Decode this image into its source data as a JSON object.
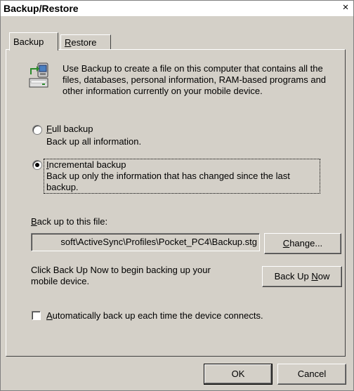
{
  "window": {
    "title": "Backup/Restore",
    "close_glyph": "×"
  },
  "tabs": [
    {
      "label_mnemonic": "",
      "label_rest": "Backup",
      "active": true
    },
    {
      "label_mnemonic": "R",
      "label_rest": "estore",
      "active": false
    }
  ],
  "intro_text": "Use Backup to create a file on this computer that contains all the files, databases, personal information, RAM-based programs and other information currently on your mobile device.",
  "options": {
    "full": {
      "mnemonic": "F",
      "title_rest": "ull backup",
      "description": "Back up all information.",
      "selected": false
    },
    "incremental": {
      "mnemonic": "I",
      "title_rest": "ncremental backup",
      "description": "Back up only the information that has changed since the last backup.",
      "selected": true
    }
  },
  "file": {
    "label_mnemonic": "B",
    "label_rest": "ack up to this file:",
    "value": "soft\\ActiveSync\\Profiles\\Pocket_PC4\\Backup.stg",
    "change_mnemonic": "C",
    "change_rest": "hange..."
  },
  "backup_now": {
    "instruction": "Click Back Up Now to begin backing up your mobile device.",
    "button_prefix": "Back Up ",
    "button_mnemonic": "N",
    "button_rest": "ow"
  },
  "auto_backup": {
    "mnemonic": "A",
    "label_rest": "utomatically back up each time the device connects.",
    "checked": false
  },
  "footer": {
    "ok": "OK",
    "cancel": "Cancel"
  },
  "icons": {
    "backup": "backup-device-icon"
  }
}
